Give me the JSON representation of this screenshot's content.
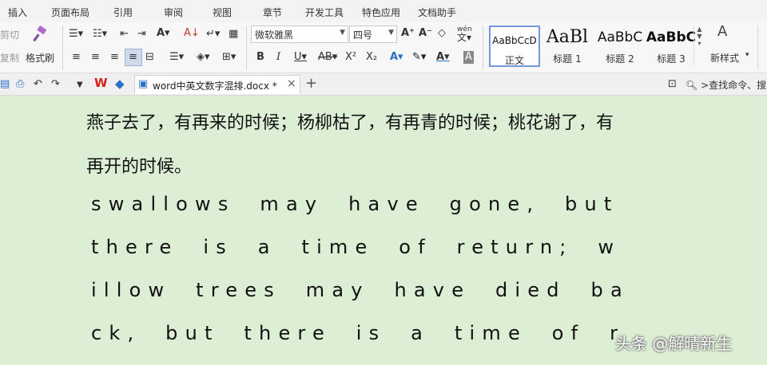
{
  "menu": {
    "tabs": [
      "插入",
      "页面布局",
      "引用",
      "审阅",
      "视图",
      "章节",
      "开发工具",
      "特色应用",
      "文档助手"
    ]
  },
  "ribbon": {
    "clipboard": {
      "cut": "剪切",
      "copy": "复制",
      "format_painter": "格式刷"
    },
    "font_name": "微软雅黑",
    "font_size": "四号",
    "styles": [
      {
        "preview": "AaBbCcD",
        "label": "正文"
      },
      {
        "preview": "AaBl",
        "label": "标题 1"
      },
      {
        "preview": "AaBbC",
        "label": "标题 2"
      },
      {
        "preview": "AaBbC",
        "label": "标题 3"
      }
    ],
    "new_style": "新样式",
    "pinyin_guide": "wén"
  },
  "tabbar": {
    "wps_logo": "W",
    "doc_tab": "word中英文数字混排.docx *",
    "close": "×",
    "add": "+",
    "search": "查找命令、搜"
  },
  "document": {
    "cn_line1": "燕子去了，有再来的时候；杨柳枯了，有再青的时候；桃花谢了，有",
    "cn_line2": "再开的时候。",
    "en_line1": "swallows may have gone,  but",
    "en_line2": "there is a time of return; w",
    "en_line3": "illow trees may have died ba",
    "en_line4": "ck,  but there is a time of r"
  },
  "watermark": "头条 @解晴新生",
  "colors": {
    "doc_bg": "#dcefd5",
    "accent": "#2a6fc9",
    "wps_red": "#d8231c"
  }
}
